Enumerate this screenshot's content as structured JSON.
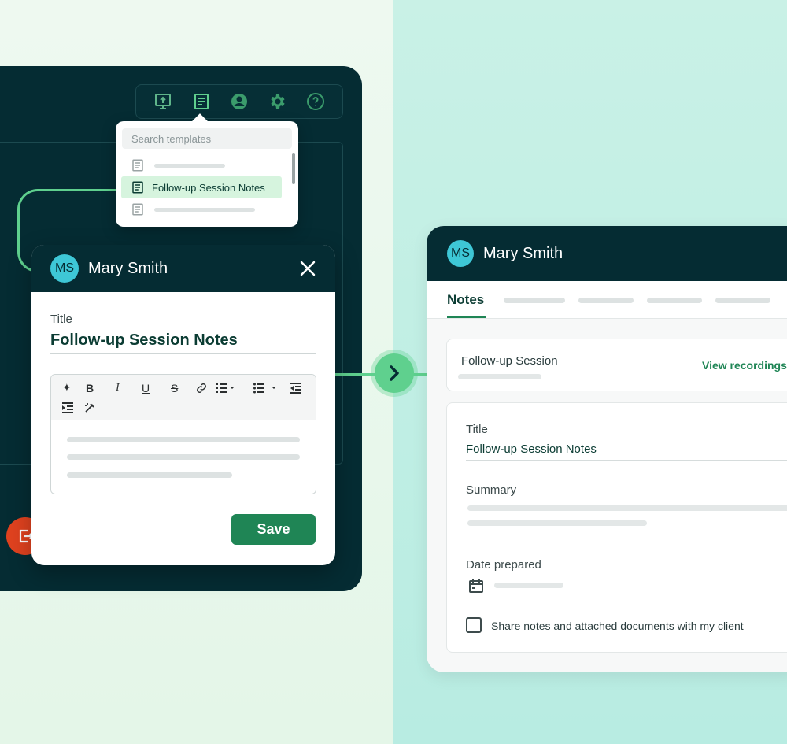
{
  "colors": {
    "dark_navy": "#052c33",
    "accent_green": "#1f8555",
    "light_green": "#5fd08e",
    "avatar_teal": "#3ec7d6",
    "danger_orange": "#e0421f"
  },
  "toolbar": {
    "icons": [
      "screen-share-icon",
      "template-icon",
      "user-icon",
      "gear-icon",
      "help-icon"
    ]
  },
  "template_dropdown": {
    "search_placeholder": "Search templates",
    "selected_item": "Follow-up Session Notes"
  },
  "modal": {
    "avatar_initials": "MS",
    "client_name": "Mary Smith",
    "title_label": "Title",
    "title_value": "Follow-up Session Notes",
    "toolbar_tools": [
      "ai-sparkle",
      "bold",
      "italic",
      "underline",
      "strikethrough",
      "link",
      "ordered-list",
      "bullet-list",
      "outdent",
      "indent",
      "clear-format"
    ],
    "tool_labels": {
      "bold": "B",
      "italic": "I",
      "underline": "U",
      "strike": "S"
    },
    "save_label": "Save"
  },
  "right_panel": {
    "avatar_initials": "MS",
    "client_name": "Mary Smith",
    "active_tab": "Notes",
    "session_title": "Follow-up Session",
    "view_recordings": "View recordings",
    "title_label": "Title",
    "title_value": "Follow-up Session Notes",
    "summary_label": "Summary",
    "date_label": "Date prepared",
    "share_label": "Share notes and attached documents with my client",
    "share_checked": false
  }
}
